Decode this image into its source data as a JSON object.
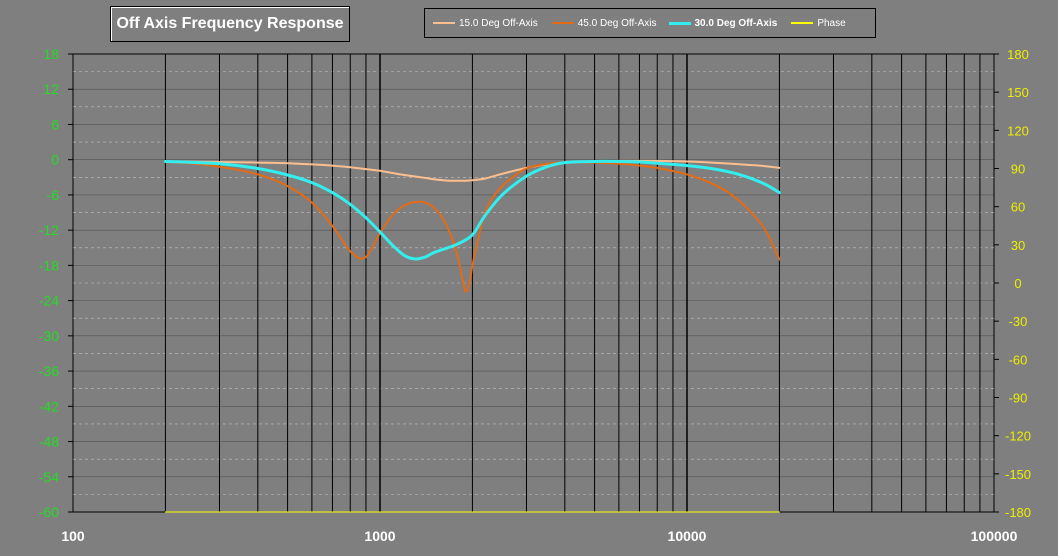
{
  "chart_data": {
    "type": "line",
    "title": "Off Axis Frequency Response",
    "xscale": "log",
    "xlim": [
      100,
      100000
    ],
    "x_ticks": [
      "100",
      "1000",
      "10000",
      "100000"
    ],
    "ylim": [
      -60,
      18
    ],
    "y_ticks": [
      "18",
      "12",
      "6",
      "0",
      "-6",
      "-12",
      "-18",
      "-24",
      "-30",
      "-36",
      "-42",
      "-48",
      "-54",
      "-60"
    ],
    "y2lim": [
      -180,
      180
    ],
    "y2_ticks": [
      "180",
      "150",
      "120",
      "90",
      "60",
      "30",
      "0",
      "-30",
      "-60",
      "-90",
      "-120",
      "-150",
      "-180"
    ],
    "grid": true,
    "legend_position": "top",
    "series": [
      {
        "name": "15.0 Deg Off-Axis",
        "color": "#fbbf8f",
        "width": 2,
        "x": [
          200,
          300,
          400,
          500,
          600,
          700,
          800,
          900,
          1000,
          1200,
          1400,
          1600,
          1800,
          2000,
          2200,
          2500,
          3000,
          3500,
          4000,
          5000,
          6000,
          7000,
          8000,
          10000,
          12000,
          14000,
          16000,
          18000,
          20000
        ],
        "y": [
          -0.3,
          -0.4,
          -0.5,
          -0.6,
          -0.8,
          -1.0,
          -1.3,
          -1.6,
          -1.9,
          -2.6,
          -3.1,
          -3.5,
          -3.6,
          -3.5,
          -3.2,
          -2.4,
          -1.4,
          -0.8,
          -0.5,
          -0.3,
          -0.2,
          -0.2,
          -0.2,
          -0.3,
          -0.5,
          -0.7,
          -0.9,
          -1.1,
          -1.4
        ]
      },
      {
        "name": "45.0 Deg Off-Axis",
        "color": "#e46b14",
        "width": 2,
        "x": [
          200,
          250,
          300,
          350,
          400,
          450,
          500,
          550,
          600,
          650,
          700,
          750,
          800,
          850,
          880,
          920,
          1000,
          1100,
          1200,
          1300,
          1400,
          1500,
          1600,
          1700,
          1800,
          1850,
          1900,
          1950,
          2000,
          2100,
          2200,
          2400,
          2700,
          3000,
          3500,
          4000,
          5000,
          6000,
          7000,
          8000,
          10000,
          12000,
          14000,
          16000,
          18000,
          20000
        ],
        "y": [
          -0.4,
          -0.7,
          -1.2,
          -1.8,
          -2.5,
          -3.4,
          -4.5,
          -5.8,
          -7.3,
          -9.2,
          -11.3,
          -13.6,
          -15.6,
          -16.7,
          -16.8,
          -16.0,
          -12.5,
          -9.4,
          -7.8,
          -7.2,
          -7.3,
          -8.2,
          -10.0,
          -12.8,
          -17.0,
          -20.0,
          -22.4,
          -21.5,
          -18.0,
          -13.0,
          -9.0,
          -5.5,
          -3.0,
          -1.5,
          -0.7,
          -0.5,
          -0.5,
          -0.7,
          -1.0,
          -1.4,
          -2.5,
          -4.0,
          -6.0,
          -8.7,
          -12.0,
          -17.0
        ]
      },
      {
        "name": "30.0 Deg Off-Axis",
        "color": "#33eeee",
        "width": 3,
        "x": [
          200,
          300,
          400,
          500,
          600,
          700,
          800,
          900,
          1000,
          1100,
          1200,
          1300,
          1400,
          1500,
          1600,
          1800,
          2000,
          2200,
          2500,
          3000,
          3500,
          4000,
          5000,
          6000,
          7000,
          8000,
          10000,
          12000,
          14000,
          16000,
          18000,
          20000
        ],
        "y": [
          -0.3,
          -0.7,
          -1.5,
          -2.6,
          -3.9,
          -5.6,
          -7.6,
          -9.9,
          -12.3,
          -14.6,
          -16.3,
          -16.9,
          -16.6,
          -15.8,
          -15.3,
          -14.3,
          -12.8,
          -9.5,
          -6.0,
          -2.8,
          -1.2,
          -0.5,
          -0.3,
          -0.3,
          -0.4,
          -0.6,
          -1.0,
          -1.5,
          -2.2,
          -3.1,
          -4.2,
          -5.6
        ]
      },
      {
        "name": "Phase",
        "color": "#ffff00",
        "width": 1,
        "axis": "right",
        "x": [
          200,
          20000
        ],
        "y": [
          -180,
          -180
        ]
      }
    ]
  }
}
